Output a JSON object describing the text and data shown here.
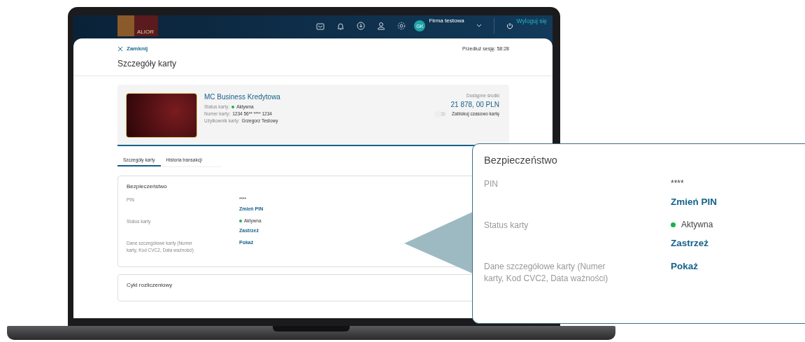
{
  "header": {
    "logo": "ALIOR",
    "initials": "GK",
    "company": "Firma testowa",
    "logout": "Wyloguj się"
  },
  "modal": {
    "close": "Zamknij",
    "session": "Przedłuż sesję: 58:28",
    "title": "Szczegóły karty"
  },
  "card": {
    "name": "MC Business Kredytowa",
    "status_label": "Status karty:",
    "status_value": "Aktywna",
    "active": true,
    "number_label": "Numer karty:",
    "number_value": "1234 56** **** 1234",
    "user_label": "Użytkownik karty:",
    "user_value": "Grzegorz Testowy",
    "funds_label": "Dostępne środki",
    "funds_value": "21 878, 00 PLN",
    "toggle": {
      "label": "Zablokuj czasowo kartę",
      "on": false
    }
  },
  "tabs": [
    {
      "label": "Szczegóły karty",
      "selected": true
    },
    {
      "label": "Historia transakcji",
      "selected": false
    }
  ],
  "sections": [
    {
      "title": "Bezpieczeństwo",
      "rows": [
        {
          "label": "PIN",
          "value": "****",
          "action": "Zmień PIN"
        },
        {
          "label": "Status karty",
          "value": "Aktywna",
          "active": true,
          "action": "Zastrzeż"
        },
        {
          "label": "Dane szczegółowe karty (Numer karty, Kod CVC2, Data ważności)",
          "action": "Pokaż"
        }
      ]
    },
    {
      "title": "Cykl rozliczeniowy"
    }
  ],
  "callout": {
    "title": "Bezpieczeństwo",
    "rows": [
      {
        "label": "PIN",
        "value": "****",
        "action": "Zmień PIN"
      },
      {
        "label": "Status karty",
        "value": "Aktywna",
        "active": true,
        "action": "Zastrzeż"
      },
      {
        "label": "Dane szczegółowe karty (Numer karty, Kod CVC2, Data ważności)",
        "action": "Pokaż"
      }
    ]
  }
}
